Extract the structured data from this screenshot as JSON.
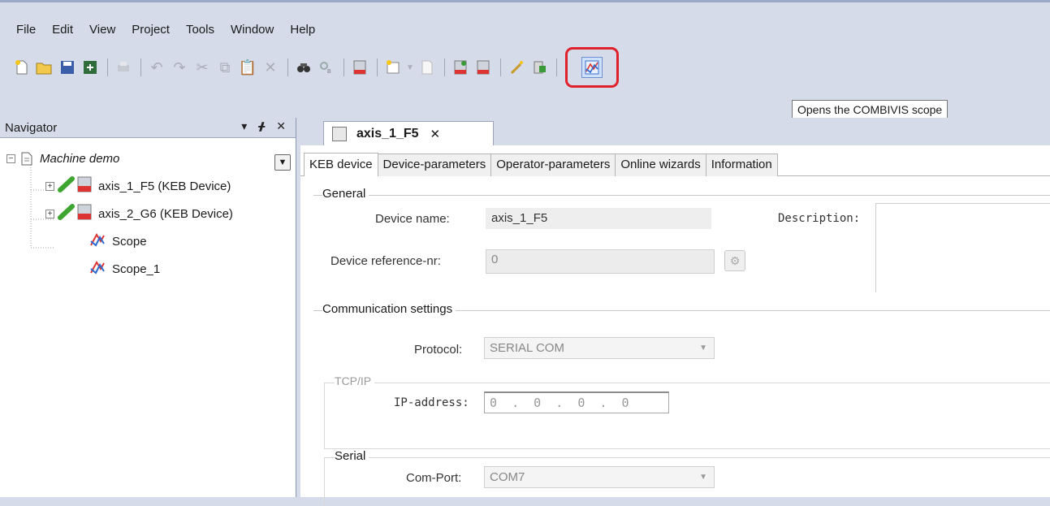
{
  "menu": [
    "File",
    "Edit",
    "View",
    "Project",
    "Tools",
    "Window",
    "Help"
  ],
  "toolbar": {
    "tooltip": "Opens the COMBIVIS scope",
    "icons": [
      "new-icon",
      "open-icon",
      "save-icon",
      "save-all-icon",
      "print-icon",
      "undo-icon",
      "redo-icon",
      "cut-icon",
      "copy-icon",
      "paste-icon",
      "delete-icon",
      "find-icon",
      "replace-icon",
      "keb-device-icon",
      "new-item-icon",
      "page-icon",
      "keb-online-icon",
      "keb-device2-icon",
      "wand-icon",
      "export-icon",
      "scope-icon"
    ]
  },
  "navigator": {
    "title": "Navigator",
    "root": "Machine demo",
    "items": [
      {
        "label": "axis_1_F5 (KEB Device)"
      },
      {
        "label": "axis_2_G6 (KEB Device)"
      },
      {
        "label": "Scope"
      },
      {
        "label": "Scope_1"
      }
    ]
  },
  "editor": {
    "doc_tab": "axis_1_F5",
    "tabs": [
      "KEB device",
      "Device-parameters",
      "Operator-parameters",
      "Online wizards",
      "Information"
    ],
    "general": {
      "title": "General",
      "device_name_label": "Device name:",
      "device_name": "axis_1_F5",
      "description_label": "Description:",
      "ref_label": "Device reference-nr:",
      "ref_value": "0"
    },
    "comm": {
      "title": "Communication settings",
      "protocol_label": "Protocol:",
      "protocol": "SERIAL COM",
      "tcpip_title": "TCP/IP",
      "ip_label": "IP-address:",
      "ip_value": "0  .  0  .  0  .  0",
      "serial_title": "Serial",
      "comport_label": "Com-Port:",
      "comport": "COM7"
    }
  },
  "colors": {
    "highlight": "#e0202a",
    "chrome": "#d6dbe9"
  }
}
